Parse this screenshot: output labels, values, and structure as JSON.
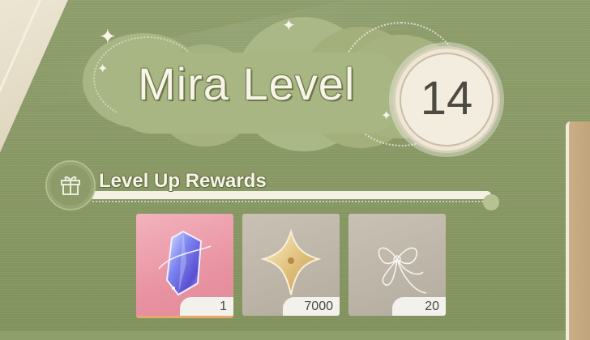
{
  "title": {
    "label": "Mira Level",
    "level": "14"
  },
  "rewards": {
    "heading": "Level Up Rewards",
    "items": [
      {
        "name": "crystal",
        "icon": "crystal-icon",
        "quantity": "1",
        "rarity_color": "#e993a2"
      },
      {
        "name": "star-currency",
        "icon": "four-point-star-icon",
        "quantity": "7000",
        "rarity_color": "#b4ad9f"
      },
      {
        "name": "thread-bow",
        "icon": "bow-thread-icon",
        "quantity": "20",
        "rarity_color": "#b4ad9f"
      }
    ]
  },
  "colors": {
    "background": "#8a9a66",
    "accent_light": "#f7f4e8",
    "badge": "#f3ede0"
  }
}
